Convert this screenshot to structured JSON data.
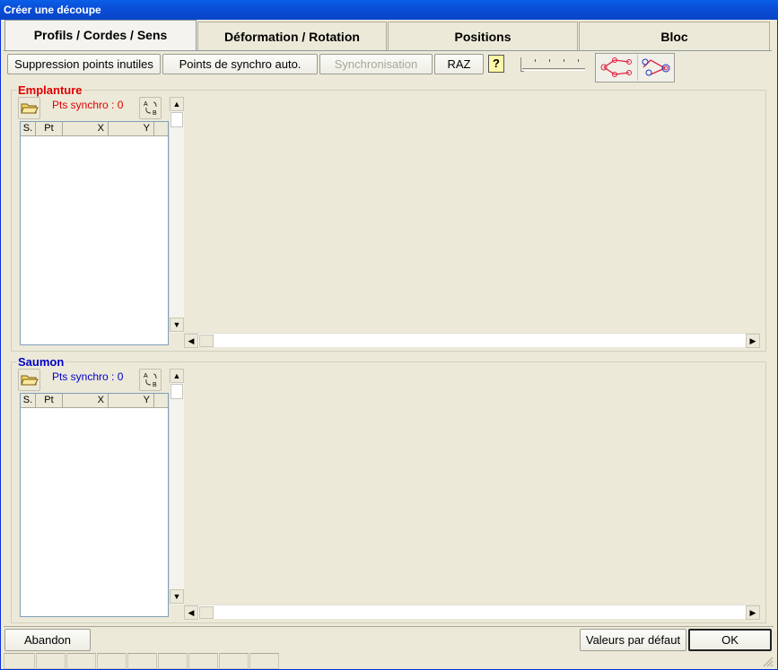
{
  "window": {
    "title": "Créer une découpe"
  },
  "tabs": [
    {
      "label": "Profils / Cordes / Sens",
      "active": true
    },
    {
      "label": "Déformation / Rotation"
    },
    {
      "label": "Positions"
    },
    {
      "label": "Bloc"
    }
  ],
  "toolbar": {
    "remove_points_label": "Suppression points inutiles",
    "auto_sync_label": "Points de synchro auto.",
    "sync_label": "Synchronisation",
    "reset_label": "RAZ",
    "help_icon": "question-mark-icon"
  },
  "emplanture": {
    "title": "Emplanture",
    "title_color": "#e00000",
    "sync_count": "Pts synchro : 0",
    "columns": [
      "S.",
      "Pt",
      "X",
      "Y"
    ]
  },
  "saumon": {
    "title": "Saumon",
    "title_color": "#0000cc",
    "sync_count": "Pts synchro : 0",
    "columns": [
      "S.",
      "Pt",
      "X",
      "Y"
    ]
  },
  "footer": {
    "abandon_label": "Abandon",
    "defaults_label": "Valeurs par défaut",
    "ok_label": "OK"
  },
  "colors": {
    "title_bar": "#0a5fe8",
    "face": "#ece9d8",
    "icon_red": "#e02040",
    "icon_blue": "#2030c0"
  }
}
